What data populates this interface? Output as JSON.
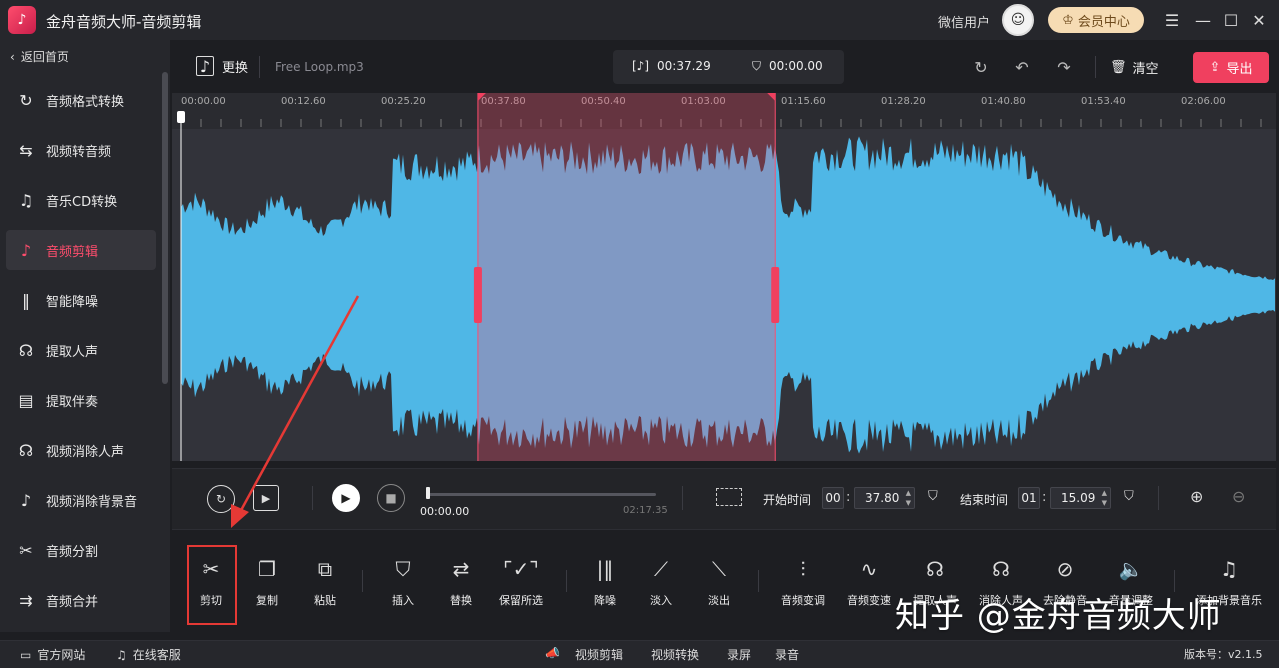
{
  "app": {
    "title": "金舟音频大师-音频剪辑",
    "user_name": "微信用户",
    "vip_label": "会员中心"
  },
  "colors": {
    "accent": "#f0405f",
    "wave": "#4fb7e6",
    "selection": "#ff4d6d",
    "bg": "#1d1e22"
  },
  "sidebar": {
    "back_label": "返回首页",
    "items": [
      {
        "label": "音频格式转换",
        "icon": "audio-convert-icon"
      },
      {
        "label": "视频转音频",
        "icon": "video-to-audio-icon"
      },
      {
        "label": "音乐CD转换",
        "icon": "cd-icon"
      },
      {
        "label": "音频剪辑",
        "icon": "audio-edit-icon",
        "active": true
      },
      {
        "label": "智能降噪",
        "icon": "denoise-icon"
      },
      {
        "label": "提取人声",
        "icon": "extract-voice-icon"
      },
      {
        "label": "提取伴奏",
        "icon": "extract-accompaniment-icon"
      },
      {
        "label": "视频消除人声",
        "icon": "remove-voice-icon"
      },
      {
        "label": "视频消除背景音",
        "icon": "remove-bg-icon"
      },
      {
        "label": "音频分割",
        "icon": "split-icon"
      },
      {
        "label": "音频合并",
        "icon": "merge-icon"
      }
    ]
  },
  "toolbar": {
    "replace_label": "更换",
    "file_name": "Free Loop.mp3",
    "total_time": "00:37.29",
    "cursor_time": "00:00.00",
    "clear_label": "清空",
    "export_label": "导出"
  },
  "ruler": {
    "ticks": [
      "00:00.00",
      "00:12.60",
      "00:25.20",
      "00:37.80",
      "00:50.40",
      "01:03.00",
      "01:15.60",
      "01:28.20",
      "01:40.80",
      "01:53.40",
      "02:06.00"
    ]
  },
  "selection": {
    "start_fraction": 0.2771,
    "end_fraction": 0.5464
  },
  "playback": {
    "current": "00:00.00",
    "total": "02:17.35",
    "progress": 0.0,
    "start_label": "开始时间",
    "start_min": "00",
    "start_sec": "37.80",
    "end_label": "结束时间",
    "end_min": "01",
    "end_sec": "15.09"
  },
  "tools": [
    {
      "label": "剪切",
      "icon": "scissors-icon"
    },
    {
      "label": "复制",
      "icon": "copy-icon"
    },
    {
      "label": "粘贴",
      "icon": "paste-icon"
    },
    {
      "label": "插入",
      "icon": "insert-icon"
    },
    {
      "label": "替换",
      "icon": "replace-icon"
    },
    {
      "label": "保留所选",
      "icon": "keep-selection-icon"
    },
    {
      "label": "降噪",
      "icon": "noise-reduce-icon"
    },
    {
      "label": "淡入",
      "icon": "fade-in-icon"
    },
    {
      "label": "淡出",
      "icon": "fade-out-icon"
    },
    {
      "label": "音频变调",
      "icon": "pitch-icon"
    },
    {
      "label": "音频变速",
      "icon": "speed-icon"
    },
    {
      "label": "提取人声",
      "icon": "extract-voice-tool-icon"
    },
    {
      "label": "消除人声",
      "icon": "remove-voice-tool-icon"
    },
    {
      "label": "去除静音",
      "icon": "mute-remove-icon"
    },
    {
      "label": "音量调整",
      "icon": "volume-icon"
    },
    {
      "label": "添加背景音乐",
      "icon": "bg-music-icon"
    }
  ],
  "status": {
    "website": "官方网站",
    "service": "在线客服",
    "video_edit": "视频剪辑",
    "video_convert": "视频转换",
    "record_screen": "录屏",
    "record_audio": "录音",
    "version": "版本号：v2.1.5"
  },
  "watermark": "知乎 @金舟音频大师"
}
